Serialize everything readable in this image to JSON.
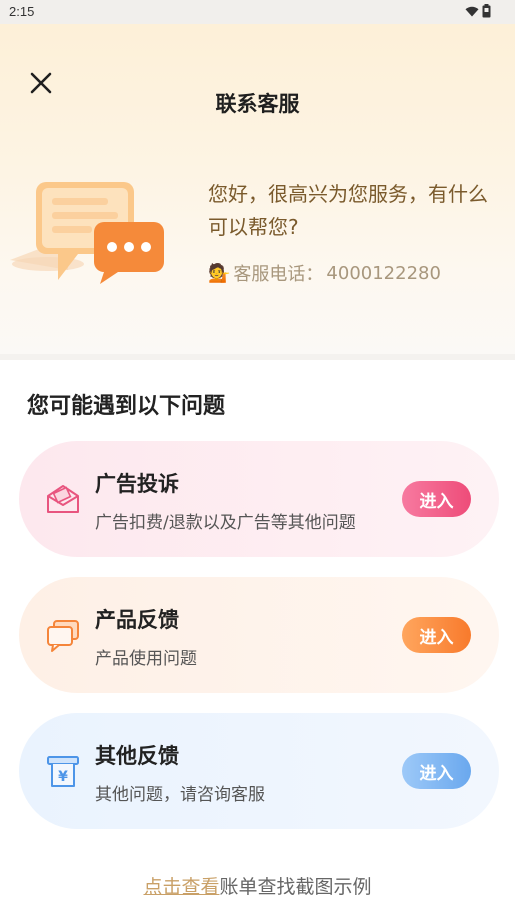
{
  "status_bar": {
    "time": "2:15"
  },
  "header": {
    "title": "联系客服"
  },
  "hero": {
    "greeting": "您好，很高兴为您服务，有什么可以帮您?",
    "hotline_label": "客服电话：",
    "hotline_number": "4000122280"
  },
  "section": {
    "title": "您可能遇到以下问题"
  },
  "cards": [
    {
      "title": "广告投诉",
      "desc": "广告扣费/退款以及广告等其他问题",
      "button": "进入"
    },
    {
      "title": "产品反馈",
      "desc": "产品使用问题",
      "button": "进入"
    },
    {
      "title": "其他反馈",
      "desc": "其他问题，请咨询客服",
      "button": "进入"
    }
  ],
  "footer": {
    "link": "点击查看",
    "text": "账单查找截图示例"
  },
  "colors": {
    "ad_accent": "#ee4c79",
    "product_accent": "#f87a2c",
    "other_accent": "#6aa8ee",
    "link": "#c9a067",
    "greeting": "#7a5a2c"
  },
  "icons": {
    "close": "close-icon",
    "ad": "envelope-icon",
    "product": "chat-bubbles-icon",
    "other": "yuan-receipt-icon",
    "wifi": "wifi-icon",
    "battery": "battery-icon"
  }
}
